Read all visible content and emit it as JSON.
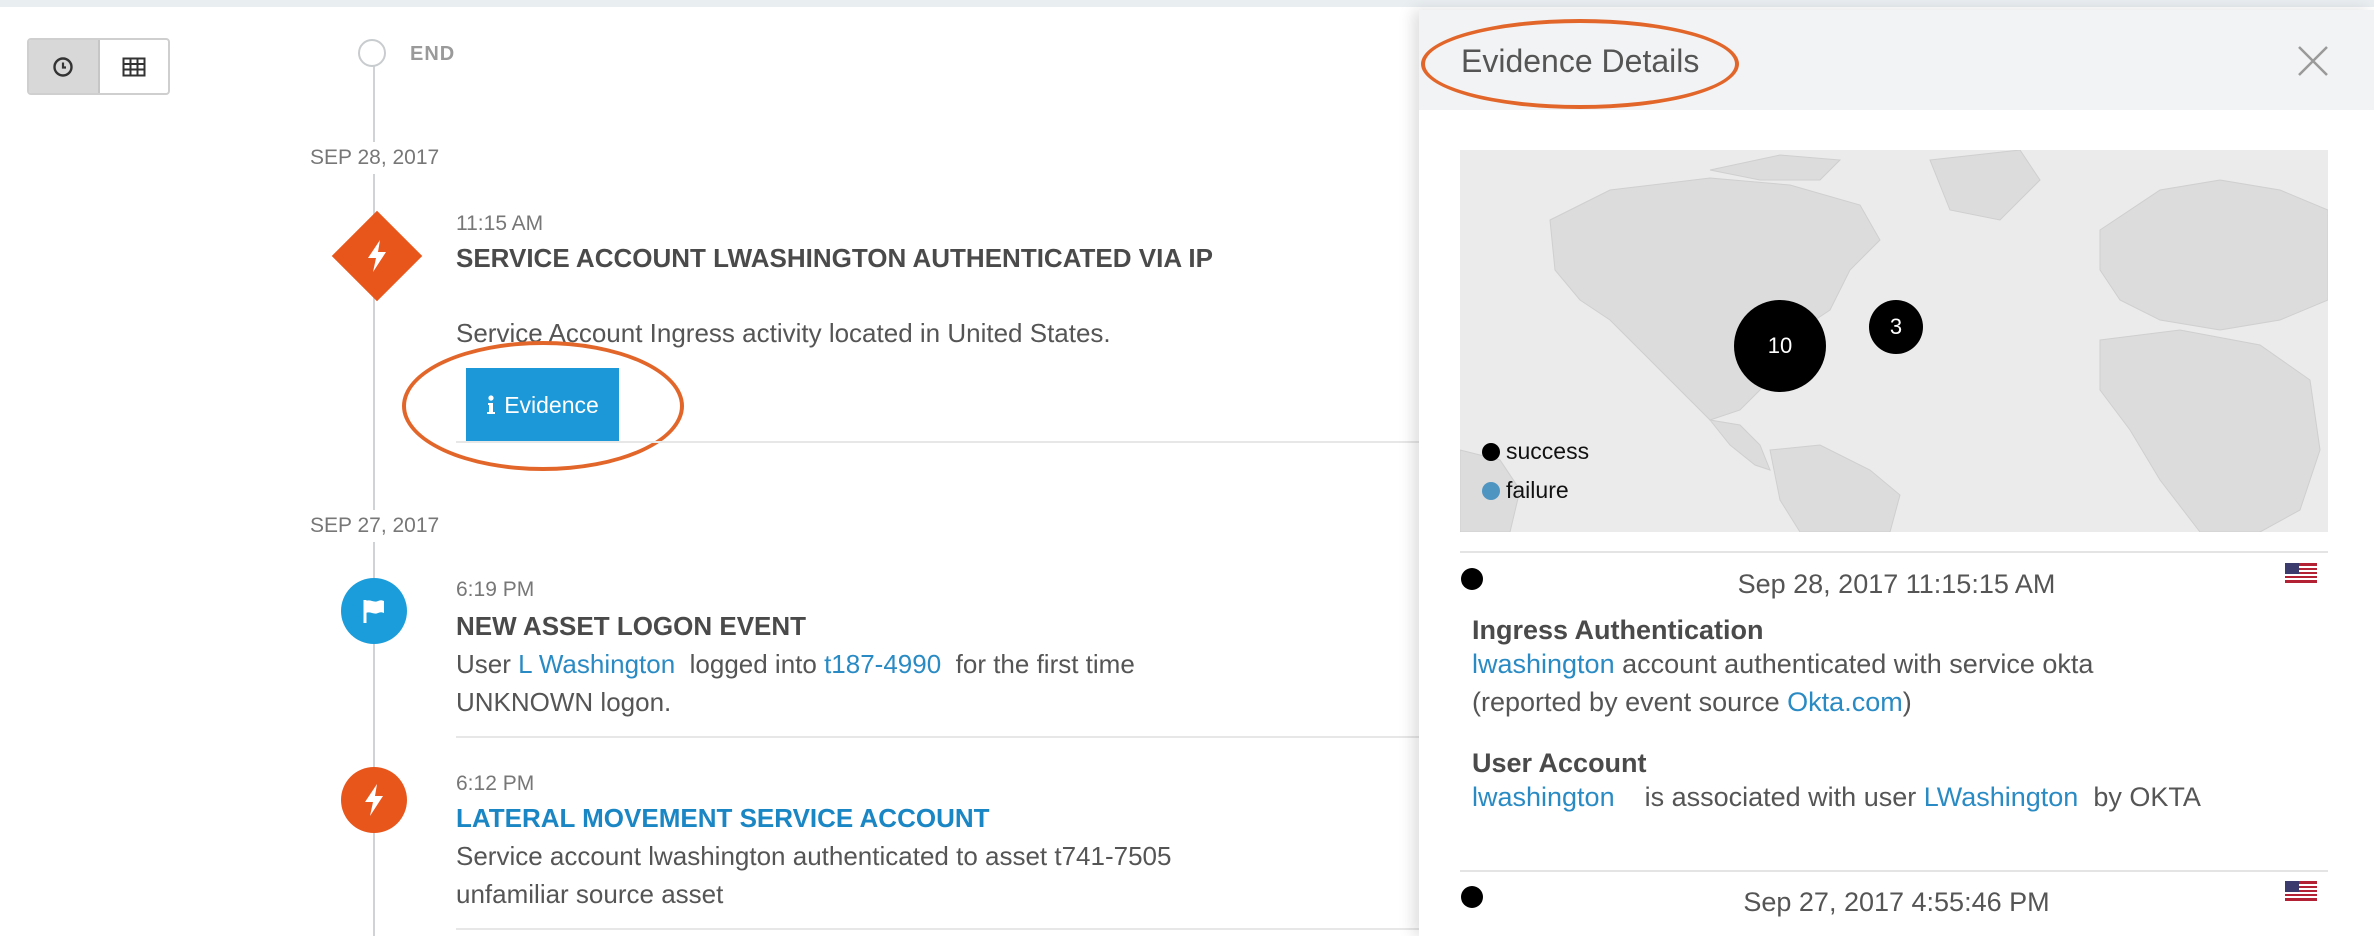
{
  "colors": {
    "accent_blue": "#1c98d9",
    "alert_orange": "#e8561c",
    "link": "#2a8bc4",
    "highlight_ring": "#e2662a"
  },
  "view_toggle": [
    {
      "name": "timeline-view",
      "icon": "clock-icon",
      "active": true
    },
    {
      "name": "table-view",
      "icon": "table-icon",
      "active": false
    }
  ],
  "timeline": {
    "end_label": "END",
    "dates": [
      "SEP 28, 2017",
      "SEP 27, 2017"
    ],
    "events": [
      {
        "icon": "lightning-icon",
        "time": "11:15 AM",
        "title": "SERVICE ACCOUNT LWASHINGTON  AUTHENTICATED VIA IP",
        "description": "Service Account Ingress activity located in United States.",
        "button_label": "Evidence",
        "button_icon": "info-icon"
      },
      {
        "icon": "flag-icon",
        "time": "6:19 PM",
        "title": "NEW ASSET LOGON EVENT",
        "line1": {
          "prefix": "User ",
          "user_link": "L Washington",
          "middle": "  logged into ",
          "asset_link": "t187-4990",
          "suffix": "  for the first time"
        },
        "line2": "UNKNOWN logon."
      },
      {
        "icon": "lightning-icon",
        "time": "6:12 PM",
        "title": "LATERAL MOVEMENT SERVICE ACCOUNT",
        "line1": "Service account lwashington authenticated to asset t741-7505",
        "line2": "unfamiliar source asset"
      }
    ]
  },
  "panel": {
    "title": "Evidence Details",
    "close_icon": "close-icon",
    "map": {
      "bubbles": [
        {
          "label": "10",
          "status": "success"
        },
        {
          "label": "3",
          "status": "success"
        }
      ],
      "legend": [
        {
          "label": "success",
          "color": "#000000"
        },
        {
          "label": "failure",
          "color": "#4f95c2"
        }
      ]
    },
    "records": [
      {
        "timestamp": "Sep 28, 2017 11:15:15 AM",
        "flag_icon": "us-flag-icon",
        "sections": [
          {
            "heading": "Ingress Authentication",
            "line1": {
              "link": "lwashington",
              "text": " account authenticated with service okta"
            },
            "line2": {
              "prefix": "(reported by event source ",
              "link": "Okta.com",
              "suffix": ")"
            }
          },
          {
            "heading": "User Account",
            "line1": {
              "link": "lwashington",
              "middle": "    is associated with user ",
              "link2": "LWashington",
              "suffix": "  by OKTA"
            }
          }
        ]
      },
      {
        "timestamp": "Sep 27, 2017 4:55:46 PM",
        "flag_icon": "us-flag-icon"
      }
    ]
  }
}
